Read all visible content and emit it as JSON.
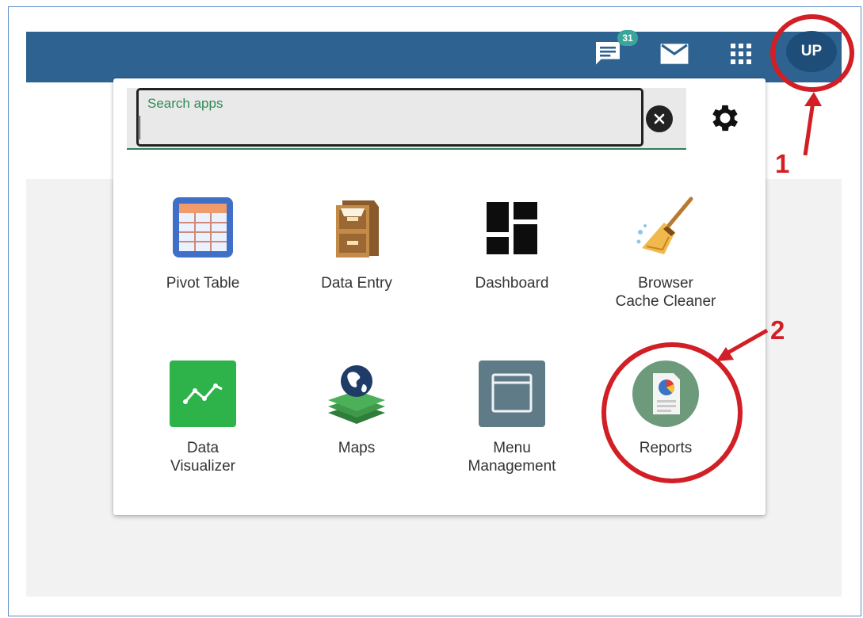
{
  "header": {
    "messages_badge": "31",
    "avatar_initials": "UP"
  },
  "search": {
    "label": "Search apps",
    "value": ""
  },
  "apps": [
    {
      "label": "Pivot Table"
    },
    {
      "label": "Data Entry"
    },
    {
      "label": "Dashboard"
    },
    {
      "label": "Browser\nCache Cleaner"
    },
    {
      "label": "Data\nVisualizer"
    },
    {
      "label": "Maps"
    },
    {
      "label": "Menu\nManagement"
    },
    {
      "label": "Reports"
    }
  ],
  "annotations": {
    "step1": "1",
    "step2": "2"
  },
  "colors": {
    "header": "#2e6290",
    "annotation": "#d21f25",
    "data_visualizer": "#2db34a",
    "menu_management": "#5f7b88",
    "reports": "#6e9a7c"
  }
}
